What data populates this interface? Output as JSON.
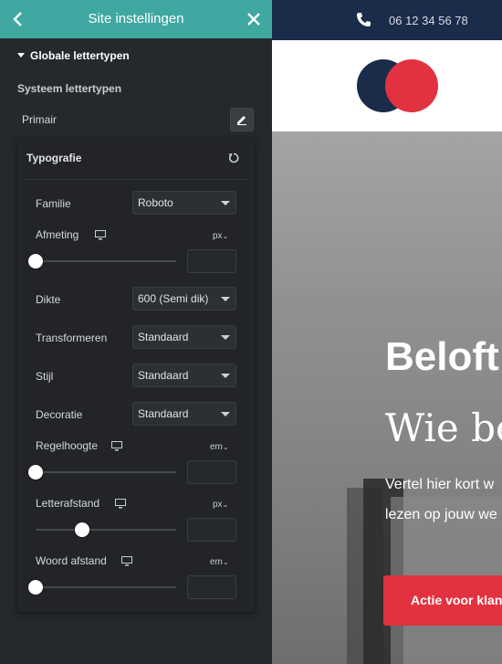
{
  "panel": {
    "title": "Site instellingen",
    "section_title": "Globale lettertypen",
    "sub_title": "Systeem lettertypen",
    "primary_label": "Primair"
  },
  "typography": {
    "title": "Typografie",
    "family": {
      "label": "Familie",
      "value": "Roboto"
    },
    "size": {
      "label": "Afmeting",
      "unit": "px",
      "value": ""
    },
    "weight": {
      "label": "Dikte",
      "value": "600 (Semi dik)"
    },
    "transform": {
      "label": "Transformeren",
      "value": "Standaard"
    },
    "style": {
      "label": "Stijl",
      "value": "Standaard"
    },
    "decoration": {
      "label": "Decoratie",
      "value": "Standaard"
    },
    "line_height": {
      "label": "Regelhoogte",
      "unit": "em",
      "value": ""
    },
    "letter_spacing": {
      "label": "Letterafstand",
      "unit": "px",
      "value": ""
    },
    "word_spacing": {
      "label": "Woord afstand",
      "unit": "em",
      "value": ""
    }
  },
  "preview": {
    "phone": "06 12 34 56 78",
    "hero_title": "Beloft",
    "hero_sub": "Wie be",
    "hero_text_1": "Vertel hier kort w",
    "hero_text_2": "lezen op jouw we",
    "cta": "Actie voor klan"
  },
  "colors": {
    "header_teal": "#3fa8a0",
    "panel_bg": "#26292c",
    "navy": "#1b2b4a",
    "brand_red": "#e3323f"
  }
}
